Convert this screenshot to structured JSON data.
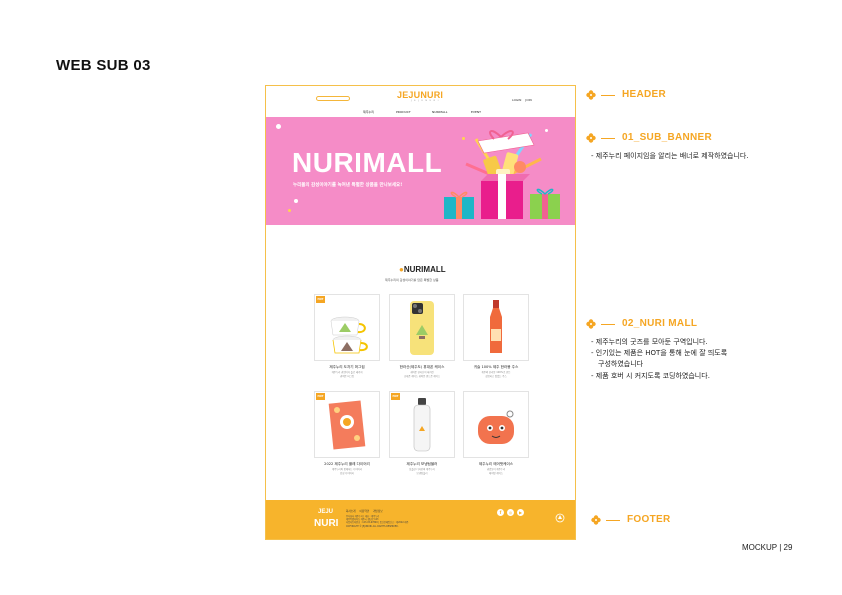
{
  "page_title": "WEB SUB 03",
  "page_number": "MOCKUP | 29",
  "accent_color": "#f5a623",
  "mockup": {
    "header": {
      "logo": "JEJUNURI",
      "logo_sub": "J E J U N U R I",
      "util": [
        "LOGIN",
        "JOIN"
      ],
      "nav": [
        "제주누리",
        "PRODUCT",
        "NURIMALL",
        "EVENT"
      ]
    },
    "banner": {
      "title": "NURIMALL",
      "subtitle": "누리몰의 감성이야기를 녹여낸 특별한 상품을 만나보세요!",
      "bg_color": "#f58cc7"
    },
    "mall": {
      "logo": "NURIMALL",
      "subtitle": "제주누리의 감성이야기를 담은 특별한 상품",
      "products": [
        {
          "name": "제주누리 도자기 머그컵",
          "desc": [
            "제주누리 귀염이가 돌로 새겨져",
            "귀여운 머그컵"
          ],
          "hot": "HOT",
          "icon": "mug-icon"
        },
        {
          "name": "한라산(제주도) 휴대폰 케이스",
          "desc": [
            "귀여운 한라산이 새겨진",
            "휴대폰 케이스 귀여운 핸드폰 케이스"
          ],
          "hot": "",
          "icon": "phone-case-icon"
        },
        {
          "name": "귀슬 100% 제주 한라봉 주스",
          "desc": [
            "제주의 한라봉 100%로 만든",
            "상큼하고 맛있는 주스"
          ],
          "hot": "",
          "icon": "juice-bottle-icon"
        },
        {
          "name": "2022 제주누리 플레 다이어리",
          "desc": [
            "제주누리와 함께하는 다이어리",
            "감성 다이어리"
          ],
          "hot": "HOT",
          "icon": "diary-icon"
        },
        {
          "name": "제주누리 보냉텀블러",
          "desc": [
            "심플한 디자인의 제주누리",
            "보냉텀블러"
          ],
          "hot": "HOT",
          "icon": "tumbler-icon"
        },
        {
          "name": "제주누리 에어팟케이스",
          "desc": [
            "귀염둥이 제주누리",
            "에어팟 케이스"
          ],
          "hot": "",
          "icon": "airpods-case-icon"
        }
      ]
    },
    "footer": {
      "logo_top": "JEJU",
      "logo_bottom": "NURI",
      "links": [
        "회사소개",
        "이용약관",
        "개인정보"
      ],
      "info": [
        "주식회사 제주누리 | 대표 : 제주누리",
        "제주특별자치도 제주시 첨단로 123",
        "사업자등록번호 : 123-45-67890 | 통신판매업신고 : 제2022-제주",
        "COPYRIGHT © JEJUNURI ALL RIGHTS RESERVED."
      ],
      "social": [
        "f",
        "◎",
        "▶"
      ]
    }
  },
  "annotations": [
    {
      "label": "HEADER",
      "desc": []
    },
    {
      "label": "01_SUB_BANNER",
      "desc": [
        "- 제주누리 페이지임을 알리는 배너로 제작하였습니다."
      ]
    },
    {
      "label": "02_NURI MALL",
      "desc": [
        "- 제주누리의 굿즈를 모아둔 구역입니다.",
        "- 인기있는 제품은 HOT을 통해 눈에 잘 띄도록",
        "구성하였습니다",
        "- 제품 호버 시 커지도록 코딩하였습니다."
      ]
    },
    {
      "label": "FOOTER",
      "desc": []
    }
  ]
}
